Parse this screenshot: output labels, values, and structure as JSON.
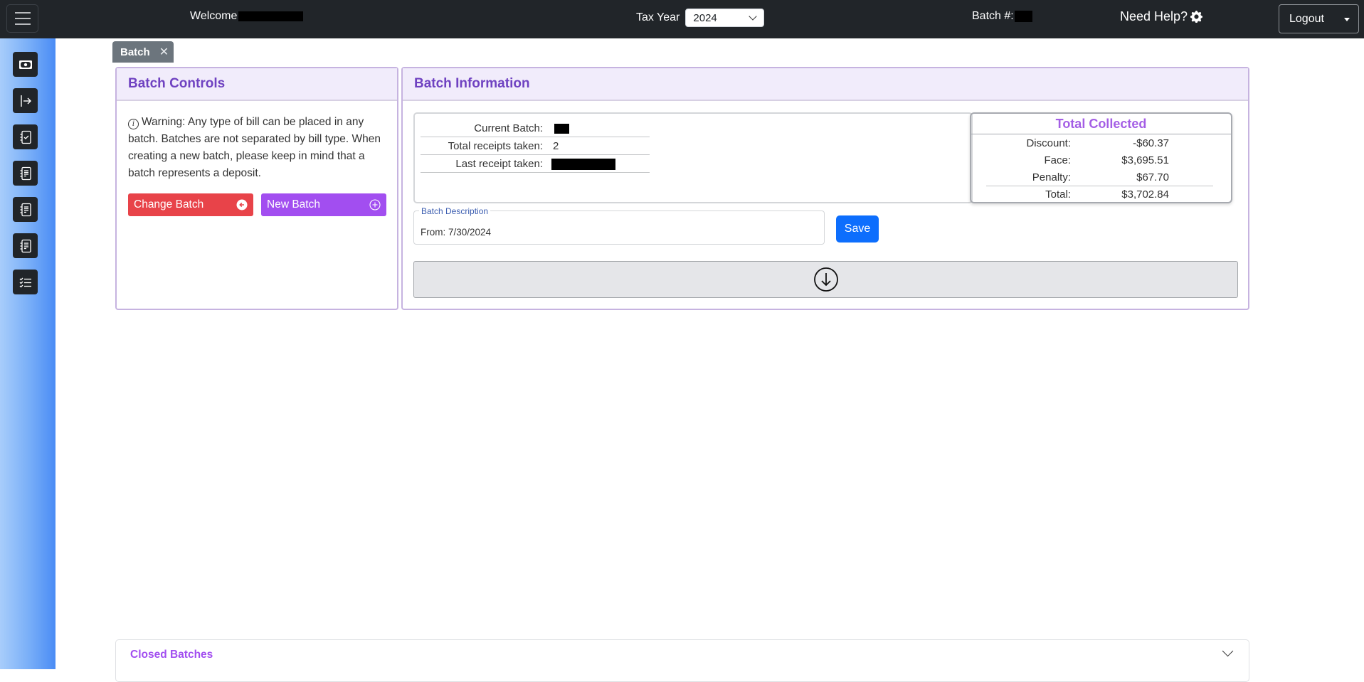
{
  "navbar": {
    "welcome_label": "Welcome",
    "welcome_name_redacted": true,
    "tax_year_label": "Tax Year",
    "tax_year_selected": "2024",
    "batch_num_label": "Batch #:",
    "batch_num_redacted": true,
    "help_label": "Need Help?",
    "help_icon": "gear-icon",
    "logout_label": "Logout"
  },
  "sidebar": {
    "items": [
      {
        "icon": "cash-icon"
      },
      {
        "icon": "arrow-bar-right-icon"
      },
      {
        "icon": "journal-check-icon"
      },
      {
        "icon": "journal-text-icon"
      },
      {
        "icon": "journal-text-icon"
      },
      {
        "icon": "journal-text-icon"
      },
      {
        "icon": "list-check-icon"
      }
    ]
  },
  "tabs": [
    {
      "label": "Batch",
      "closable": true
    }
  ],
  "batch_controls": {
    "title": "Batch Controls",
    "warning": "Warning: Any type of bill can be placed in any batch. Batches are not separated by bill type. When creating a new batch, please keep in mind that a batch represents a deposit.",
    "change_batch_label": "Change Batch",
    "new_batch_label": "New Batch"
  },
  "batch_info": {
    "title": "Batch Information",
    "rows": [
      {
        "label": "Current Batch:",
        "value": "",
        "redacted": true
      },
      {
        "label": "Total receipts taken:",
        "value": "2",
        "redacted": false
      },
      {
        "label": "Last receipt taken:",
        "value": "",
        "redacted": true
      }
    ],
    "total_collected": {
      "title": "Total Collected",
      "rows": [
        {
          "label": "Discount:",
          "value": "-$60.37"
        },
        {
          "label": "Face:",
          "value": "$3,695.51"
        },
        {
          "label": "Penalty:",
          "value": "$67.70"
        },
        {
          "label": "Total:",
          "value": "$3,702.84"
        }
      ]
    },
    "description_label": "Batch Description",
    "description_value": "From: 7/30/2024",
    "save_label": "Save"
  },
  "closed_batches": {
    "title": "Closed Batches"
  },
  "colors": {
    "navbar_bg": "#212529",
    "accent_purple": "#6f42c1",
    "change_batch_red": "#e84349",
    "new_batch_purple": "#a24ef0",
    "save_blue": "#0d6efd"
  }
}
